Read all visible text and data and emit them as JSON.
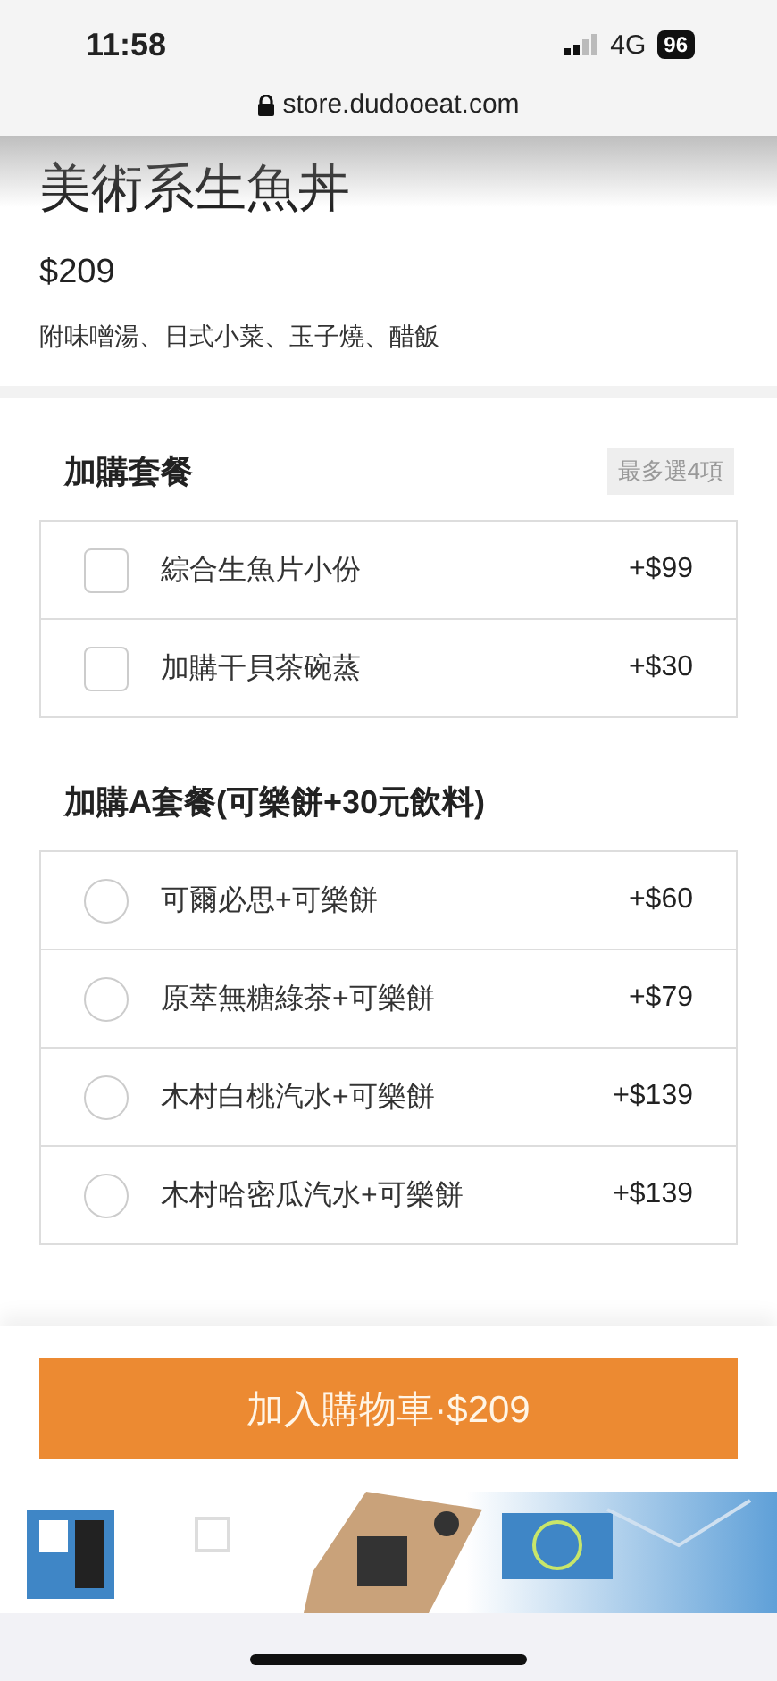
{
  "status_bar": {
    "time": "11:58",
    "network": "4G",
    "battery": "96"
  },
  "browser": {
    "url": "store.dudooeat.com"
  },
  "product": {
    "title": "美術系生魚丼",
    "price": "$209",
    "description": "附味噌湯、日式小菜、玉子燒、醋飯"
  },
  "groups": [
    {
      "title": "加購套餐",
      "badge": "最多選4項",
      "kind": "checkbox",
      "options": [
        {
          "label": "綜合生魚片小份",
          "price": "+$99",
          "checked": false
        },
        {
          "label": "加購干貝茶碗蒸",
          "price": "+$30",
          "checked": false
        }
      ]
    },
    {
      "title": "加購A套餐(可樂餅+30元飲料)",
      "kind": "radio",
      "options": [
        {
          "label": "可爾必思+可樂餅",
          "price": "+$60",
          "selected": false
        },
        {
          "label": "原萃無糖綠茶+可樂餅",
          "price": "+$79",
          "selected": false
        },
        {
          "label": "木村白桃汽水+可樂餅",
          "price": "+$139",
          "selected": false
        },
        {
          "label": "木村哈密瓜汽水+可樂餅",
          "price": "+$139",
          "selected": false
        }
      ]
    }
  ],
  "cart_button": {
    "label": "加入購物車·$209"
  }
}
